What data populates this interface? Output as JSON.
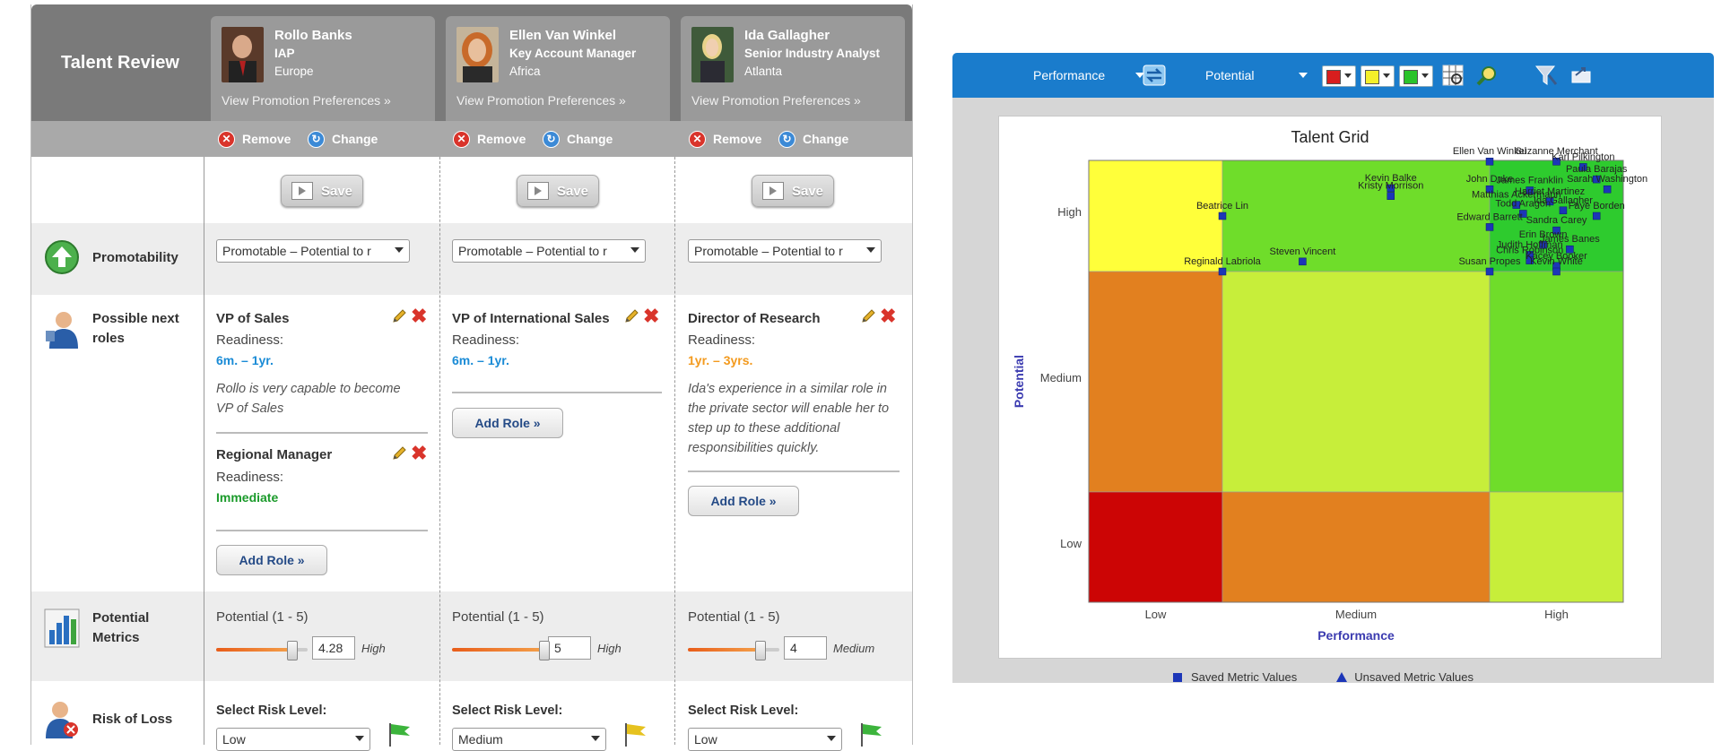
{
  "review": {
    "title": "Talent Review",
    "employees": [
      {
        "name": "Rollo Banks",
        "title": "IAP",
        "location": "Europe",
        "promo_link": "View Promotion Preferences »"
      },
      {
        "name": "Ellen Van Winkel",
        "title": "Key Account Manager",
        "location": "Africa",
        "promo_link": "View Promotion Preferences »"
      },
      {
        "name": "Ida Gallagher",
        "title": "Senior Industry Analyst",
        "location": "Atlanta",
        "promo_link": "View Promotion Preferences »"
      }
    ],
    "actions": {
      "remove": "Remove",
      "change": "Change"
    },
    "save_label": "Save",
    "rows": {
      "promotability": "Promotability",
      "next_roles": "Possible next roles",
      "potential_metrics": "Potential Metrics",
      "risk_of_loss": "Risk of Loss"
    },
    "promotability_value": "Promotable – Potential to r",
    "readiness_label": "Readiness:",
    "add_role": "Add Role »",
    "roles": {
      "rollo_role1": {
        "title": "VP of Sales",
        "readiness": "6m. – 1yr.",
        "note_line1": "Rollo is very capable to become",
        "note_line2": "VP of Sales"
      },
      "rollo_role2": {
        "title": "Regional Manager",
        "readiness": "Immediate"
      },
      "ellen_role1": {
        "title": "VP of International Sales",
        "readiness": "6m. – 1yr."
      },
      "ida_role1": {
        "title": "Director of Research",
        "readiness": "1yr. – 3yrs.",
        "note_line1": "Ida's experience in a similar role in",
        "note_line2": "the private sector will enable her to",
        "note_line3": "step up to these additional",
        "note_line4": "responsibilities quickly."
      }
    },
    "potential_label": "Potential  (1 - 5)",
    "potential": [
      {
        "value": "4.28",
        "fraction": 0.82,
        "level": "High"
      },
      {
        "value": "5",
        "fraction": 1.0,
        "level": "High"
      },
      {
        "value": "4",
        "fraction": 0.78,
        "level": "Medium"
      }
    ],
    "risk_label": "Select Risk Level:",
    "risk": [
      {
        "value": "Low",
        "flag_color": "#3cb43c"
      },
      {
        "value": "Medium",
        "flag_color": "#e6c21f"
      },
      {
        "value": "Low",
        "flag_color": "#3cb43c"
      }
    ]
  },
  "toolbar": {
    "x_select": "Performance",
    "y_select": "Potential",
    "swatches": [
      "#d81e1e",
      "#f5f02a",
      "#2bc42b"
    ],
    "icons": [
      "swap-icon",
      "grid-icon",
      "zoom-icon",
      "funnel-icon",
      "export-icon"
    ]
  },
  "legend": {
    "saved": "Saved Metric Values",
    "unsaved": "Unsaved Metric Values"
  },
  "chart_data": {
    "type": "scatter",
    "title": "Talent Grid",
    "xlabel": "Performance",
    "ylabel": "Potential",
    "x_ticks": [
      "Low",
      "Medium",
      "High"
    ],
    "y_ticks": [
      "High",
      "Medium",
      "Low"
    ],
    "cell_colors": [
      [
        "#ffff3a",
        "#6fdd2a",
        "#2ecb2e"
      ],
      [
        "#e2801f",
        "#c7ee3a",
        "#6fdd2a"
      ],
      [
        "#cc0505",
        "#e2801f",
        "#c7ee3a"
      ]
    ],
    "grid": false,
    "legend_position": "bottom",
    "series": [
      {
        "name": "Saved Metric Values",
        "marker": "square",
        "color": "#1c36b8",
        "points": [
          {
            "label": "Kevin Balke",
            "x": 1.63,
            "y": 2.75
          },
          {
            "label": "Ellen Van Winkel",
            "x": 2.0,
            "y": 2.99
          },
          {
            "label": "Suzanne Merchant",
            "x": 2.5,
            "y": 2.99
          },
          {
            "label": "Karl Pilkington",
            "x": 2.7,
            "y": 2.94
          },
          {
            "label": "Paula Barajas",
            "x": 2.8,
            "y": 2.83
          },
          {
            "label": "Sarah Washington",
            "x": 2.88,
            "y": 2.74
          },
          {
            "label": "John Duke",
            "x": 2.0,
            "y": 2.74
          },
          {
            "label": "James Franklin",
            "x": 2.3,
            "y": 2.73
          },
          {
            "label": "Kristy Morrison",
            "x": 1.63,
            "y": 2.68
          },
          {
            "label": "Matthias Ackermann",
            "x": 2.2,
            "y": 2.6
          },
          {
            "label": "Harriet Martinez",
            "x": 2.45,
            "y": 2.63
          },
          {
            "label": "Todd Aragon",
            "x": 2.25,
            "y": 2.52
          },
          {
            "label": "Ida Gallagher",
            "x": 2.55,
            "y": 2.55
          },
          {
            "label": "Beatrice Lin",
            "x": 1.0,
            "y": 2.5
          },
          {
            "label": "Faye Borden",
            "x": 2.8,
            "y": 2.5
          },
          {
            "label": "Edward Barrett",
            "x": 2.0,
            "y": 2.4
          },
          {
            "label": "Sandra Carey",
            "x": 2.5,
            "y": 2.37
          },
          {
            "label": "Erin Brown",
            "x": 2.4,
            "y": 2.24
          },
          {
            "label": "James Banes",
            "x": 2.6,
            "y": 2.2
          },
          {
            "label": "Judith Hoffman",
            "x": 2.3,
            "y": 2.15
          },
          {
            "label": "Steven Vincent",
            "x": 1.3,
            "y": 2.09
          },
          {
            "label": "Chris  Robinson",
            "x": 2.3,
            "y": 2.1
          },
          {
            "label": "Kacey Booker",
            "x": 2.5,
            "y": 2.05
          },
          {
            "label": "Susan Propes",
            "x": 2.0,
            "y": 2.0
          },
          {
            "label": "Reginald Labriola",
            "x": 1.0,
            "y": 2.0
          },
          {
            "label": "Kevin White",
            "x": 2.5,
            "y": 2.0
          }
        ]
      }
    ]
  }
}
